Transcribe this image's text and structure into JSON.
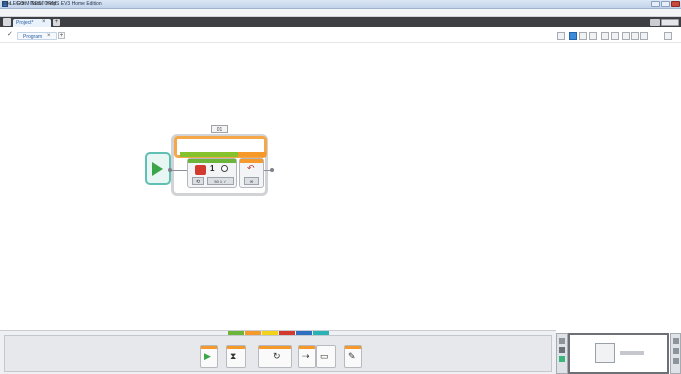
{
  "window": {
    "title": "LEGO MINDSTORMS EV3 Home Edition"
  },
  "menu": {
    "items": [
      "File",
      "Edit",
      "Tools",
      "Help"
    ]
  },
  "project_tabs": {
    "active": "Project*",
    "close": "×",
    "add": "+"
  },
  "program_tabs": {
    "active": "Program",
    "close": "×",
    "add": "+"
  },
  "loop": {
    "name": "01"
  },
  "motor_block": {
    "mode": "⟲",
    "power": "1",
    "params": "50 1 ✓"
  },
  "end_block": {
    "value": "∞"
  },
  "palette": {
    "tab_colors": [
      "#6ab53a",
      "#f59a2a",
      "#f2d21b",
      "#d23a2f",
      "#2f6fc1",
      "#2ab3b5"
    ],
    "blocks": [
      "▶",
      "⧗",
      "↻",
      "⇢",
      "▭",
      "✎"
    ]
  },
  "colors": {
    "accent": "#3c8ad8",
    "action": "#6ab53a",
    "flow": "#f59a2a"
  }
}
